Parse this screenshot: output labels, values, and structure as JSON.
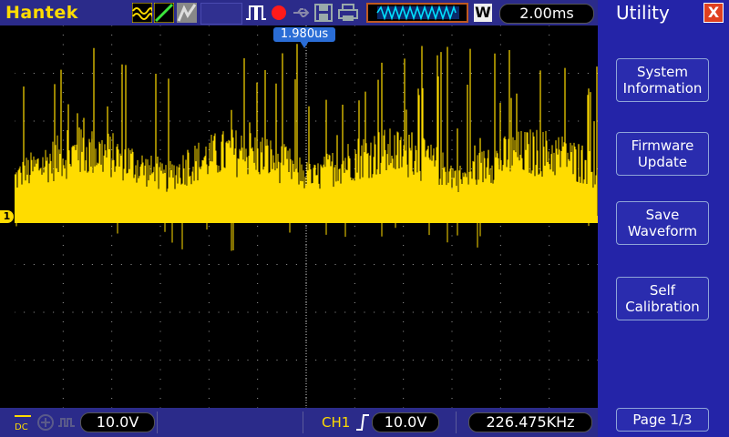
{
  "brand": "Hantek",
  "timebase": "2.00ms",
  "trigger_position": "1.980us",
  "ch1_marker": "1",
  "waveform_mode_letter": "W",
  "bottom": {
    "ch1_volts_div": "10.0V",
    "trigger_channel": "CH1",
    "trigger_level": "10.0V",
    "frequency": "226.475KHz"
  },
  "sidebar": {
    "title": "Utility",
    "close": "X",
    "items": [
      {
        "label": "System\nInformation"
      },
      {
        "label": "Firmware\nUpdate"
      },
      {
        "label": "Save\nWaveform"
      },
      {
        "label": "Self\nCalibration"
      }
    ],
    "page": "Page 1/3"
  },
  "colors": {
    "trace": "#ffdc00",
    "bar": "#2b2b8a",
    "sidebar": "#2424a8",
    "run_indicator": "#ff1a1a"
  }
}
